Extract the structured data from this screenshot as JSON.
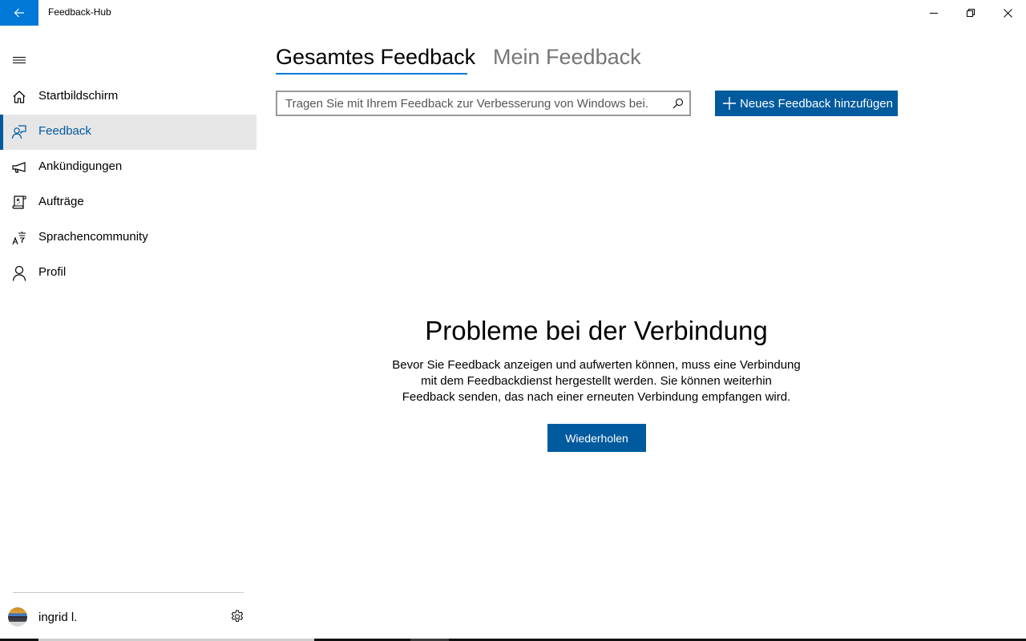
{
  "window": {
    "title": "Feedback-Hub",
    "accent_color": "#0078d7",
    "buttons": {
      "back": "back-arrow-icon",
      "minimize": "minimize-icon",
      "maximize": "restore-icon",
      "close": "close-icon"
    }
  },
  "sidebar": {
    "menu_icon": "hamburger-icon",
    "items": [
      {
        "label": "Startbildschirm",
        "icon": "home-icon",
        "active": false
      },
      {
        "label": "Feedback",
        "icon": "feedback-icon",
        "active": true
      },
      {
        "label": "Ankündigungen",
        "icon": "megaphone-icon",
        "active": false
      },
      {
        "label": "Aufträge",
        "icon": "quests-icon",
        "active": false
      },
      {
        "label": "Sprachencommunity",
        "icon": "language-icon",
        "active": false
      },
      {
        "label": "Profil",
        "icon": "person-icon",
        "active": false
      }
    ],
    "user": {
      "name": "ingrid l.",
      "settings_icon": "gear-icon"
    }
  },
  "main": {
    "tabs": [
      {
        "label": "Gesamtes Feedback",
        "selected": true
      },
      {
        "label": "Mein Feedback",
        "selected": false
      }
    ],
    "search": {
      "placeholder": "Tragen Sie mit Ihrem Feedback zur Verbesserung von Windows bei.",
      "value": ""
    },
    "new_feedback_button": "Neues Feedback hinzufügen",
    "error": {
      "title": "Probleme bei der Verbindung",
      "line1": "Bevor Sie Feedback anzeigen und aufwerten können, muss eine Verbindung",
      "line2": "mit dem Feedbackdienst hergestellt werden. Sie können weiterhin",
      "line3": "Feedback senden, das nach einer erneuten Verbindung empfangen wird.",
      "retry_button": "Wiederholen"
    },
    "button_color": "#005a9e"
  }
}
